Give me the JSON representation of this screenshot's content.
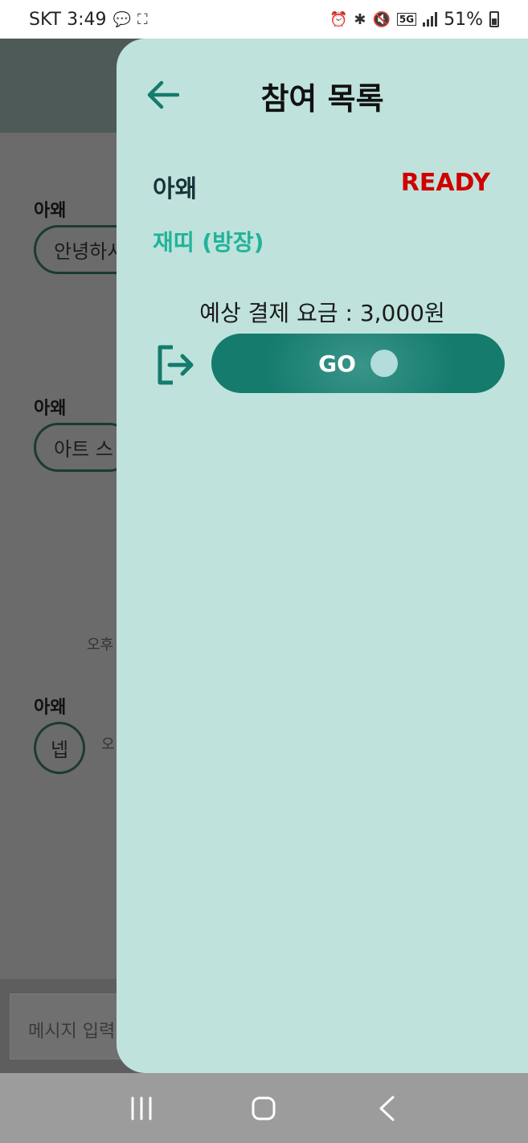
{
  "status_bar": {
    "carrier_time": "SKT 3:49",
    "network": "5G",
    "battery": "51%"
  },
  "chat": {
    "messages": [
      {
        "sender": "아왜",
        "text": "안녕하시"
      },
      {
        "sender": "아왜",
        "text": "아트 스"
      },
      {
        "sender": "아왜",
        "text": "넵",
        "time": "오"
      }
    ],
    "time_fragment": "오후",
    "input_placeholder": "메시지 입력"
  },
  "drawer": {
    "title": "참여 목록",
    "participant": {
      "name": "아왜",
      "status": "READY"
    },
    "host": "재띠 (방장)",
    "fee_text": "예상 결제 요금 : 3,000원",
    "go_label": "GO"
  },
  "colors": {
    "drawer_bg": "#bfe3dc",
    "accent": "#147b6d",
    "ready": "#d10000",
    "host": "#22b39a"
  },
  "icons": {
    "back": "arrow-left-icon",
    "exit": "exit-icon",
    "nav_recent": "recent-apps-icon",
    "nav_home": "home-icon",
    "nav_back": "back-icon"
  }
}
